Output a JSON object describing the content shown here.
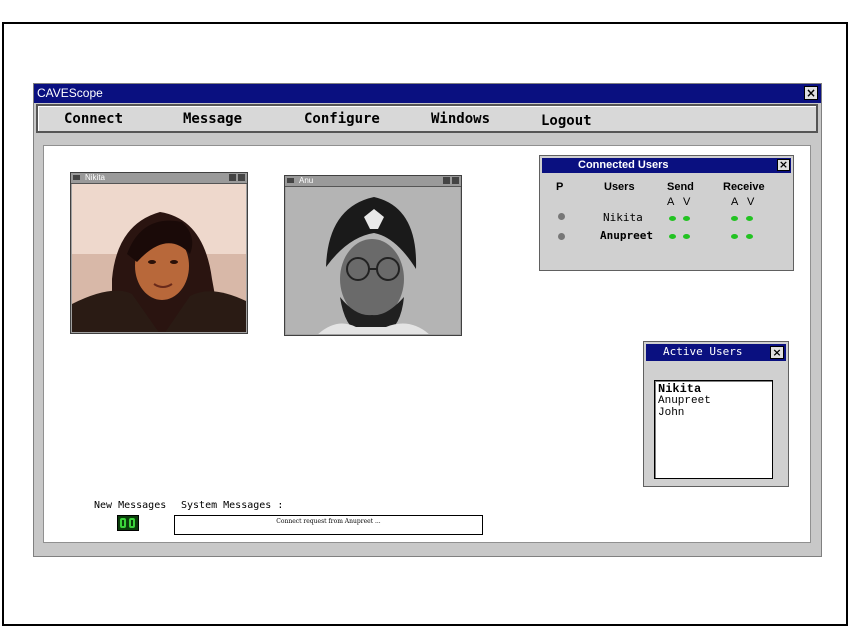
{
  "window": {
    "title": "CAVEScope",
    "close_label": "×"
  },
  "menu": {
    "connect": "Connect",
    "message": "Message",
    "configure": "Configure",
    "windows": "Windows",
    "logout": "Logout"
  },
  "videos": [
    {
      "label": "Nikita"
    },
    {
      "label": "Anu"
    }
  ],
  "connected_users": {
    "title": "Connected Users",
    "close_label": "×",
    "headers": {
      "p": "P",
      "users": "Users",
      "send": "Send",
      "receive": "Receive"
    },
    "sub_headers": {
      "a": "A",
      "v": "V"
    },
    "users": [
      {
        "name": "Nikita"
      },
      {
        "name": "Anupreet"
      }
    ],
    "led_color": "#22c322"
  },
  "active_users": {
    "title": "Active Users",
    "close_label": "×",
    "items": [
      "Nikita",
      "Anupreet",
      "John"
    ]
  },
  "messages": {
    "new_messages_label": "New Messages",
    "system_messages_label": "System Messages :",
    "system_message_text": "Connect request from Anupreet ..."
  },
  "colors": {
    "titlebar": "#0a1080",
    "background": "#c8c8c8"
  }
}
